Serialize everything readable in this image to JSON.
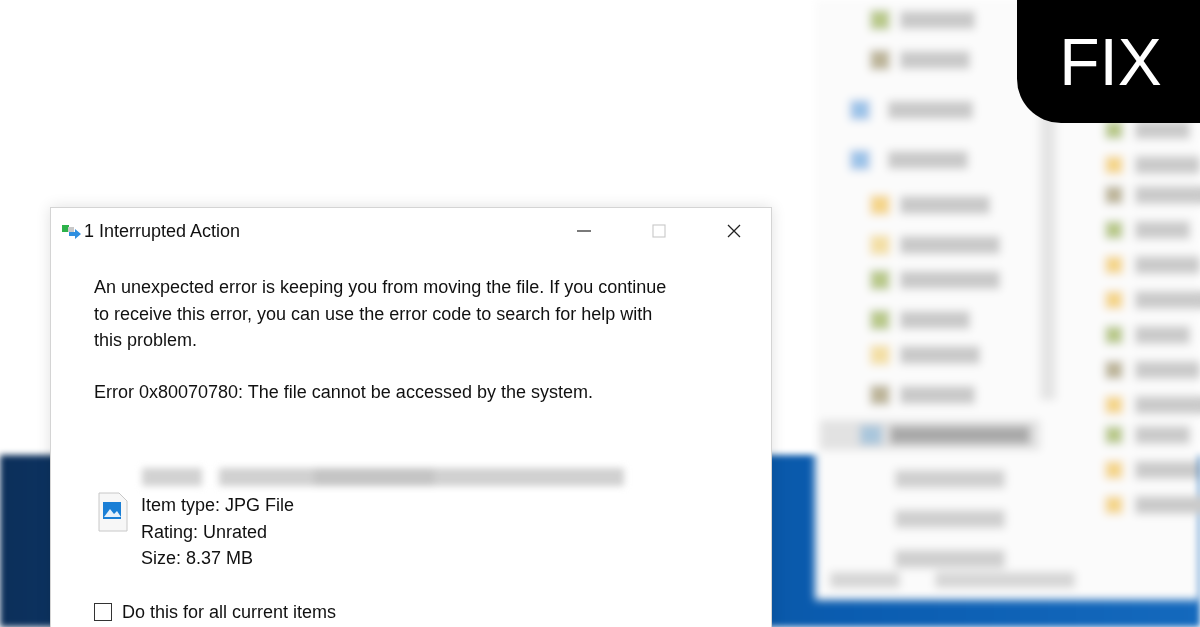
{
  "dialog": {
    "title": "1 Interrupted Action",
    "title_buttons": [
      {
        "kind": "minimize",
        "disabled": false
      },
      {
        "kind": "maximize",
        "disabled": true
      },
      {
        "kind": "close",
        "disabled": false
      }
    ],
    "message": "An unexpected error is keeping you from moving the file. If you continue to receive this error, you can use the error code to search for help with this problem.",
    "error": "Error 0x80070780: The file cannot be accessed by the system.",
    "details": [
      "Item type: JPG File",
      "Rating: Unrated",
      "Size: 8.37 MB"
    ],
    "checkbox": {
      "label": "Do this for all current items",
      "checked": false
    }
  },
  "badge": {
    "text": "FIX"
  }
}
